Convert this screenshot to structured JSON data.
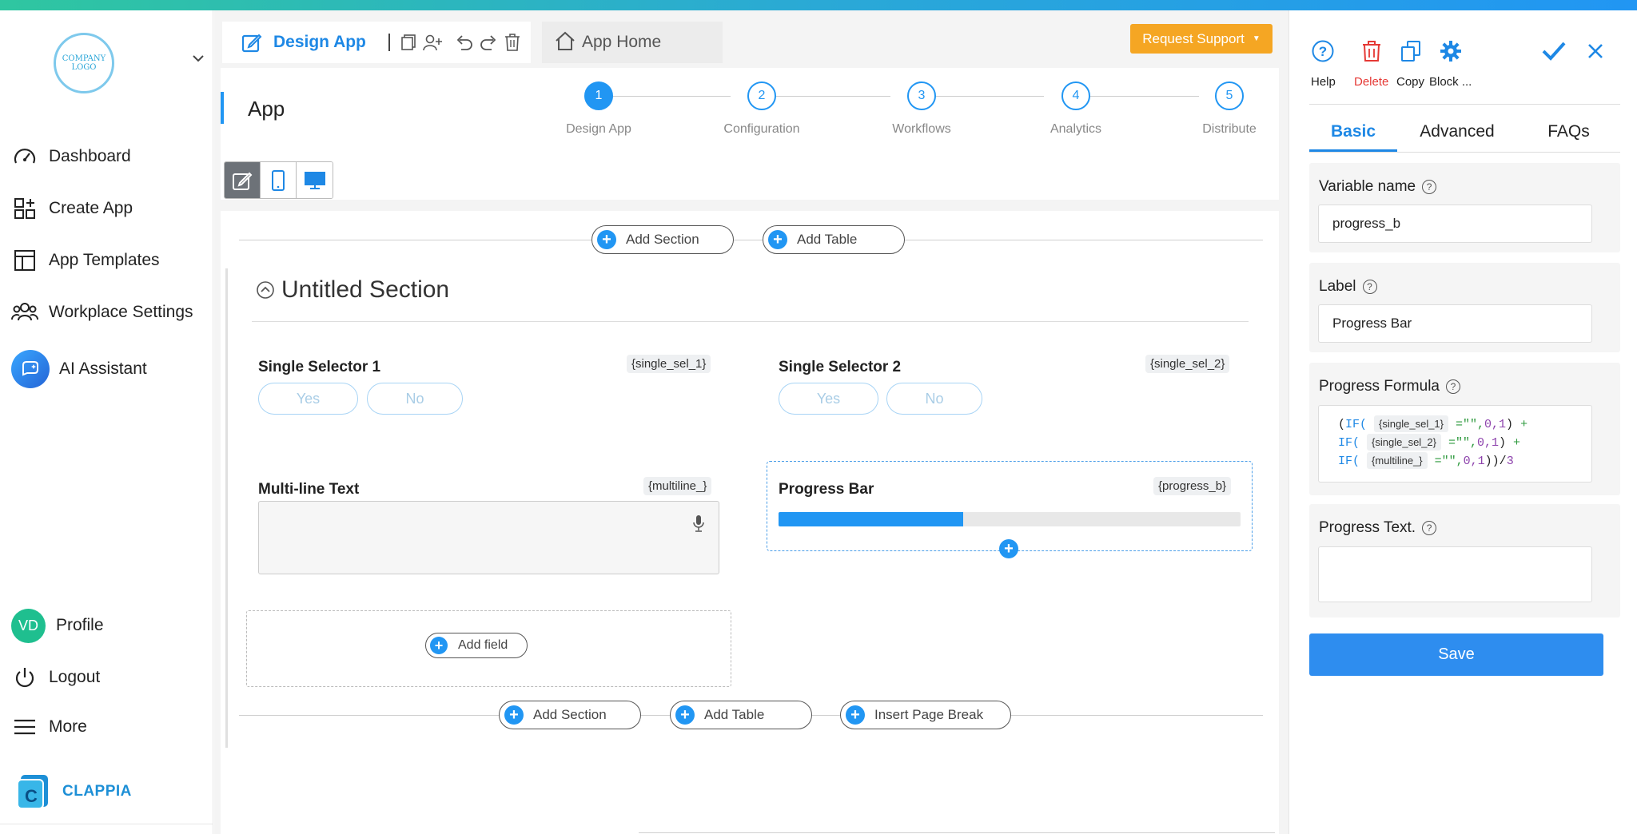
{
  "sidebar": {
    "logo_text": "COMPANY LOGO",
    "items": [
      {
        "label": "Dashboard",
        "icon": "gauge-icon"
      },
      {
        "label": "Create App",
        "icon": "grid-plus-icon"
      },
      {
        "label": "App Templates",
        "icon": "template-icon"
      },
      {
        "label": "Workplace Settings",
        "icon": "users-icon"
      },
      {
        "label": "AI Assistant",
        "icon": "ai-assistant-icon"
      }
    ],
    "bottom_items": [
      {
        "label": "Profile",
        "initials": "VD"
      },
      {
        "label": "Logout",
        "icon": "power-icon"
      },
      {
        "label": "More",
        "icon": "hamburger-icon"
      }
    ],
    "brand": "CLAPPIA"
  },
  "toolbar": {
    "design_app_label": "Design App",
    "app_home_label": "App Home",
    "request_support_label": "Request Support"
  },
  "header": {
    "app_title": "App",
    "steps": [
      {
        "num": "1",
        "label": "Design App"
      },
      {
        "num": "2",
        "label": "Configuration"
      },
      {
        "num": "3",
        "label": "Workflows"
      },
      {
        "num": "4",
        "label": "Analytics"
      },
      {
        "num": "5",
        "label": "Distribute"
      }
    ]
  },
  "canvas": {
    "add_section": "Add Section",
    "add_table": "Add Table",
    "insert_page_break": "Insert Page Break",
    "add_field": "Add field",
    "section_title": "Untitled Section",
    "fields": {
      "single1": {
        "label": "Single Selector 1",
        "var": "{single_sel_1}",
        "yes": "Yes",
        "no": "No"
      },
      "single2": {
        "label": "Single Selector 2",
        "var": "{single_sel_2}",
        "yes": "Yes",
        "no": "No"
      },
      "multiline": {
        "label": "Multi-line Text",
        "var": "{multiline_}"
      },
      "progress": {
        "label": "Progress Bar",
        "var": "{progress_b}",
        "value": 0.4
      }
    }
  },
  "panel": {
    "actions": {
      "help": "Help",
      "delete": "Delete",
      "copy": "Copy",
      "block": "Block ..."
    },
    "tabs": {
      "basic": "Basic",
      "advanced": "Advanced",
      "faqs": "FAQs"
    },
    "variable_name_label": "Variable name",
    "variable_name_value": "progress_b",
    "label_label": "Label",
    "label_value": "Progress Bar",
    "formula_label": "Progress Formula",
    "formula": {
      "if": "IF(",
      "tag1": "{single_sel_1}",
      "tag2": "{single_sel_2}",
      "tag3": "{multiline_}",
      "open": "(",
      "eq": " =\"\",",
      "args": "0,1",
      "close": ")",
      "plus": " +",
      "end": "))/",
      "div": "3"
    },
    "progress_text_label": "Progress Text.",
    "save_label": "Save"
  },
  "colors": {
    "accent": "#2196f3",
    "support": "#f5a623",
    "delete": "#e53935"
  }
}
